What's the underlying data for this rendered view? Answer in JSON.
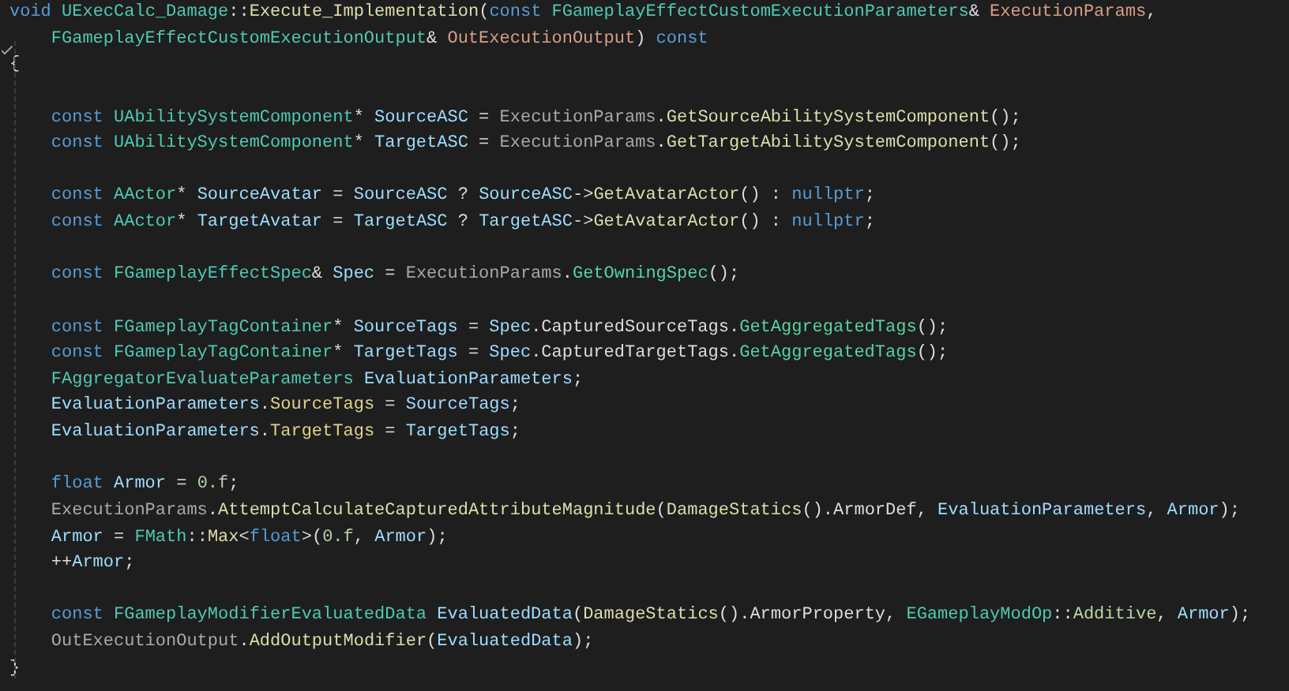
{
  "editor": {
    "lines": [
      {
        "kind": "top",
        "tokens": [
          {
            "kind": "keyword",
            "text": "void "
          },
          {
            "kind": "type",
            "text": "UExecCalc_Damage"
          },
          {
            "kind": "plain",
            "text": "::"
          },
          {
            "kind": "function",
            "text": "Execute_Implementation"
          },
          {
            "kind": "plain",
            "text": "("
          },
          {
            "kind": "keyword",
            "text": "const "
          },
          {
            "kind": "type",
            "text": "FGameplayEffectCustomExecutionParameters"
          },
          {
            "kind": "plain",
            "text": "& "
          },
          {
            "kind": "param",
            "text": "ExecutionParams"
          },
          {
            "kind": "plain",
            "text": ","
          }
        ]
      },
      {
        "kind": "indented",
        "tokens": [
          {
            "kind": "type",
            "text": "FGameplayEffectCustomExecutionOutput"
          },
          {
            "kind": "plain",
            "text": "& "
          },
          {
            "kind": "param",
            "text": "OutExecutionOutput"
          },
          {
            "kind": "plain",
            "text": ") "
          },
          {
            "kind": "keyword",
            "text": "const"
          }
        ]
      },
      {
        "kind": "top",
        "tokens": [
          {
            "kind": "plain",
            "text": "{"
          }
        ]
      },
      {
        "kind": "blank"
      },
      {
        "kind": "indented",
        "tokens": [
          {
            "kind": "keyword",
            "text": "const "
          },
          {
            "kind": "type",
            "text": "UAbilitySystemComponent"
          },
          {
            "kind": "plain",
            "text": "* "
          },
          {
            "kind": "local",
            "text": "SourceASC"
          },
          {
            "kind": "plain",
            "text": " = "
          },
          {
            "kind": "param-use",
            "text": "ExecutionParams"
          },
          {
            "kind": "plain",
            "text": "."
          },
          {
            "kind": "function",
            "text": "GetSourceAbilitySystemComponent"
          },
          {
            "kind": "plain",
            "text": "();"
          }
        ]
      },
      {
        "kind": "indented",
        "tokens": [
          {
            "kind": "keyword",
            "text": "const "
          },
          {
            "kind": "type",
            "text": "UAbilitySystemComponent"
          },
          {
            "kind": "plain",
            "text": "* "
          },
          {
            "kind": "local",
            "text": "TargetASC"
          },
          {
            "kind": "plain",
            "text": " = "
          },
          {
            "kind": "param-use",
            "text": "ExecutionParams"
          },
          {
            "kind": "plain",
            "text": "."
          },
          {
            "kind": "function",
            "text": "GetTargetAbilitySystemComponent"
          },
          {
            "kind": "plain",
            "text": "();"
          }
        ]
      },
      {
        "kind": "blank"
      },
      {
        "kind": "indented",
        "tokens": [
          {
            "kind": "keyword",
            "text": "const "
          },
          {
            "kind": "type",
            "text": "AActor"
          },
          {
            "kind": "plain",
            "text": "* "
          },
          {
            "kind": "local",
            "text": "SourceAvatar"
          },
          {
            "kind": "plain",
            "text": " = "
          },
          {
            "kind": "local",
            "text": "SourceASC"
          },
          {
            "kind": "plain",
            "text": " ? "
          },
          {
            "kind": "local",
            "text": "SourceASC"
          },
          {
            "kind": "plain",
            "text": "->"
          },
          {
            "kind": "function",
            "text": "GetAvatarActor"
          },
          {
            "kind": "plain",
            "text": "() : "
          },
          {
            "kind": "keyword",
            "text": "nullptr"
          },
          {
            "kind": "plain",
            "text": ";"
          }
        ]
      },
      {
        "kind": "indented",
        "tokens": [
          {
            "kind": "keyword",
            "text": "const "
          },
          {
            "kind": "type",
            "text": "AActor"
          },
          {
            "kind": "plain",
            "text": "* "
          },
          {
            "kind": "local",
            "text": "TargetAvatar"
          },
          {
            "kind": "plain",
            "text": " = "
          },
          {
            "kind": "local",
            "text": "TargetASC"
          },
          {
            "kind": "plain",
            "text": " ? "
          },
          {
            "kind": "local",
            "text": "TargetASC"
          },
          {
            "kind": "plain",
            "text": "->"
          },
          {
            "kind": "function",
            "text": "GetAvatarActor"
          },
          {
            "kind": "plain",
            "text": "() : "
          },
          {
            "kind": "keyword",
            "text": "nullptr"
          },
          {
            "kind": "plain",
            "text": ";"
          }
        ]
      },
      {
        "kind": "blank"
      },
      {
        "kind": "indented",
        "tokens": [
          {
            "kind": "keyword",
            "text": "const "
          },
          {
            "kind": "type",
            "text": "FGameplayEffectSpec"
          },
          {
            "kind": "plain",
            "text": "& "
          },
          {
            "kind": "local",
            "text": "Spec"
          },
          {
            "kind": "plain",
            "text": " = "
          },
          {
            "kind": "param-use",
            "text": "ExecutionParams"
          },
          {
            "kind": "plain",
            "text": "."
          },
          {
            "kind": "method",
            "text": "GetOwningSpec"
          },
          {
            "kind": "plain",
            "text": "();"
          }
        ]
      },
      {
        "kind": "blank"
      },
      {
        "kind": "indented",
        "tokens": [
          {
            "kind": "keyword",
            "text": "const "
          },
          {
            "kind": "type",
            "text": "FGameplayTagContainer"
          },
          {
            "kind": "plain",
            "text": "* "
          },
          {
            "kind": "local",
            "text": "SourceTags"
          },
          {
            "kind": "plain",
            "text": " = "
          },
          {
            "kind": "local",
            "text": "Spec"
          },
          {
            "kind": "plain",
            "text": ".CapturedSourceTags."
          },
          {
            "kind": "method",
            "text": "GetAggregatedTags"
          },
          {
            "kind": "plain",
            "text": "();"
          }
        ]
      },
      {
        "kind": "indented",
        "tokens": [
          {
            "kind": "keyword",
            "text": "const "
          },
          {
            "kind": "type",
            "text": "FGameplayTagContainer"
          },
          {
            "kind": "plain",
            "text": "* "
          },
          {
            "kind": "local",
            "text": "TargetTags"
          },
          {
            "kind": "plain",
            "text": " = "
          },
          {
            "kind": "local",
            "text": "Spec"
          },
          {
            "kind": "plain",
            "text": ".CapturedTargetTags."
          },
          {
            "kind": "method",
            "text": "GetAggregatedTags"
          },
          {
            "kind": "plain",
            "text": "();"
          }
        ]
      },
      {
        "kind": "indented",
        "tokens": [
          {
            "kind": "type",
            "text": "FAggregatorEvaluateParameters "
          },
          {
            "kind": "local",
            "text": "EvaluationParameters"
          },
          {
            "kind": "plain",
            "text": ";"
          }
        ]
      },
      {
        "kind": "indented",
        "tokens": [
          {
            "kind": "local",
            "text": "EvaluationParameters"
          },
          {
            "kind": "plain",
            "text": "."
          },
          {
            "kind": "field",
            "text": "SourceTags"
          },
          {
            "kind": "plain",
            "text": " = "
          },
          {
            "kind": "local",
            "text": "SourceTags"
          },
          {
            "kind": "plain",
            "text": ";"
          }
        ]
      },
      {
        "kind": "indented",
        "tokens": [
          {
            "kind": "local",
            "text": "EvaluationParameters"
          },
          {
            "kind": "plain",
            "text": "."
          },
          {
            "kind": "field",
            "text": "TargetTags"
          },
          {
            "kind": "plain",
            "text": " = "
          },
          {
            "kind": "local",
            "text": "TargetTags"
          },
          {
            "kind": "plain",
            "text": ";"
          }
        ]
      },
      {
        "kind": "blank"
      },
      {
        "kind": "indented",
        "tokens": [
          {
            "kind": "keyword",
            "text": "float "
          },
          {
            "kind": "local",
            "text": "Armor"
          },
          {
            "kind": "plain",
            "text": " = "
          },
          {
            "kind": "number",
            "text": "0.f"
          },
          {
            "kind": "plain",
            "text": ";"
          }
        ]
      },
      {
        "kind": "indented",
        "tokens": [
          {
            "kind": "param-use",
            "text": "ExecutionParams"
          },
          {
            "kind": "plain",
            "text": "."
          },
          {
            "kind": "function",
            "text": "AttemptCalculateCapturedAttributeMagnitude"
          },
          {
            "kind": "plain",
            "text": "("
          },
          {
            "kind": "function",
            "text": "DamageStatics"
          },
          {
            "kind": "plain",
            "text": "().ArmorDef, "
          },
          {
            "kind": "local",
            "text": "EvaluationParameters"
          },
          {
            "kind": "plain",
            "text": ", "
          },
          {
            "kind": "local",
            "text": "Armor"
          },
          {
            "kind": "plain",
            "text": ");"
          }
        ]
      },
      {
        "kind": "indented",
        "tokens": [
          {
            "kind": "local",
            "text": "Armor"
          },
          {
            "kind": "plain",
            "text": " = "
          },
          {
            "kind": "type",
            "text": "FMath"
          },
          {
            "kind": "plain",
            "text": "::"
          },
          {
            "kind": "function",
            "text": "Max"
          },
          {
            "kind": "plain",
            "text": "<"
          },
          {
            "kind": "keyword",
            "text": "float"
          },
          {
            "kind": "plain",
            "text": ">("
          },
          {
            "kind": "number",
            "text": "0.f"
          },
          {
            "kind": "plain",
            "text": ", "
          },
          {
            "kind": "local",
            "text": "Armor"
          },
          {
            "kind": "plain",
            "text": ");"
          }
        ]
      },
      {
        "kind": "indented",
        "tokens": [
          {
            "kind": "plain",
            "text": "++"
          },
          {
            "kind": "local",
            "text": "Armor"
          },
          {
            "kind": "plain",
            "text": ";"
          }
        ]
      },
      {
        "kind": "blank"
      },
      {
        "kind": "indented",
        "tokens": [
          {
            "kind": "keyword",
            "text": "const "
          },
          {
            "kind": "type",
            "text": "FGameplayModifierEvaluatedData "
          },
          {
            "kind": "local",
            "text": "EvaluatedData"
          },
          {
            "kind": "plain",
            "text": "("
          },
          {
            "kind": "function",
            "text": "DamageStatics"
          },
          {
            "kind": "plain",
            "text": "().ArmorProperty, "
          },
          {
            "kind": "type",
            "text": "EGameplayModOp"
          },
          {
            "kind": "plain",
            "text": "::"
          },
          {
            "kind": "enum",
            "text": "Additive"
          },
          {
            "kind": "plain",
            "text": ", "
          },
          {
            "kind": "local",
            "text": "Armor"
          },
          {
            "kind": "plain",
            "text": ");"
          }
        ]
      },
      {
        "kind": "indented",
        "tokens": [
          {
            "kind": "param-use",
            "text": "OutExecutionOutput"
          },
          {
            "kind": "plain",
            "text": "."
          },
          {
            "kind": "function",
            "text": "AddOutputModifier"
          },
          {
            "kind": "plain",
            "text": "("
          },
          {
            "kind": "local",
            "text": "EvaluatedData"
          },
          {
            "kind": "plain",
            "text": ");"
          }
        ]
      },
      {
        "kind": "top",
        "tokens": [
          {
            "kind": "plain",
            "text": "}"
          }
        ]
      }
    ]
  }
}
